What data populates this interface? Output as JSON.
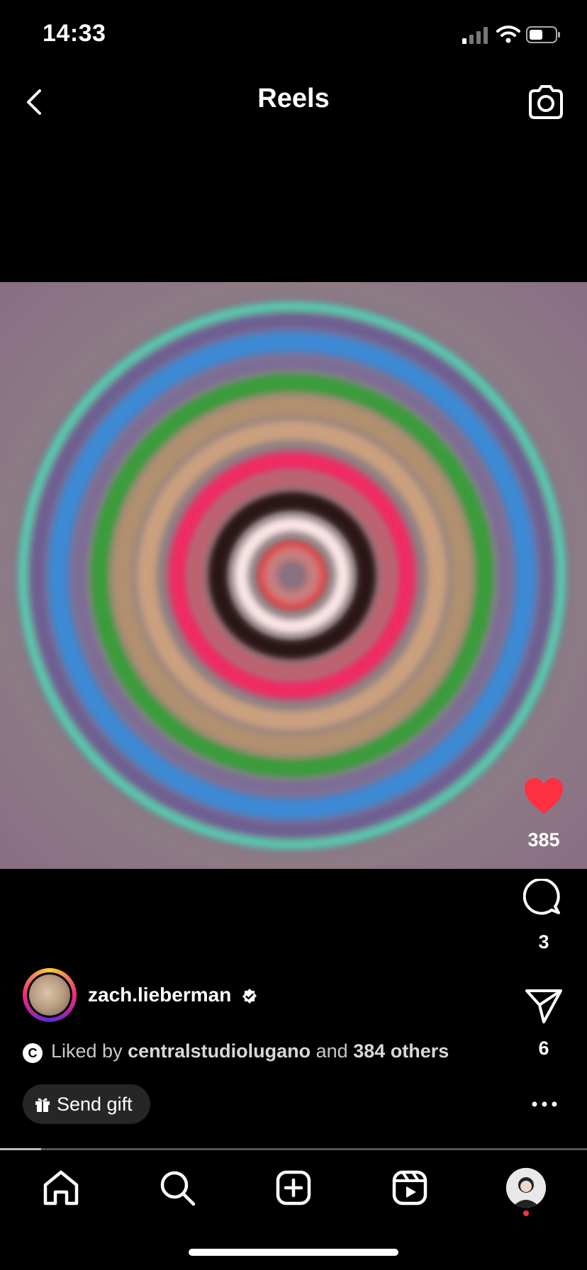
{
  "status_bar": {
    "time": "14:33"
  },
  "header": {
    "title": "Reels"
  },
  "reel": {
    "likes": "385",
    "comments": "3",
    "shares": "6",
    "author": {
      "username": "zach.lieberman",
      "verified": true
    },
    "liked_by": {
      "prefix": "Liked by",
      "user": "centralstudiolugano",
      "joiner": "and",
      "others": "384 others"
    },
    "creator_badge": "C",
    "send_gift": "Send gift",
    "progress": 0.07
  },
  "colors": {
    "like": "#ff3040",
    "background": "#000000",
    "chip": "#262626"
  },
  "icons": {
    "back": "chevron-left-icon",
    "camera": "camera-icon",
    "like": "heart-icon",
    "comment": "comment-icon",
    "share": "paper-plane-icon",
    "more": "more-horizontal-icon",
    "home": "home-icon",
    "search": "search-icon",
    "create": "plus-square-icon",
    "reels": "reels-icon",
    "profile": "profile-avatar"
  }
}
